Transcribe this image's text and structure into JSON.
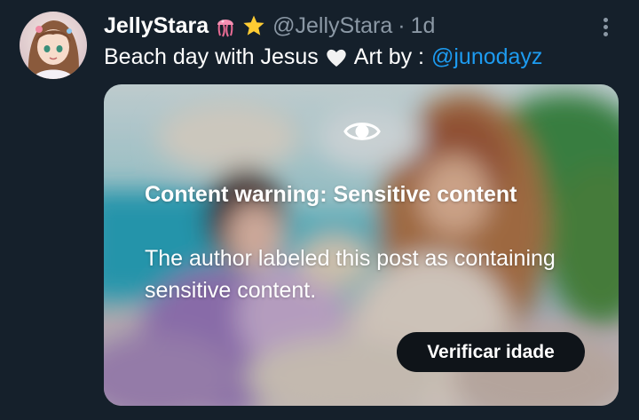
{
  "tweet": {
    "display_name": "JellyStara",
    "emojis": [
      "jellyfish-emoji",
      "star-emoji"
    ],
    "handle": "@JellyStara",
    "separator": "·",
    "time": "1d",
    "text_before": "Beach day with Jesus",
    "text_heart": "white-heart-emoji",
    "text_after": "Art by :",
    "mention": "@junodayz"
  },
  "media": {
    "warning_title": "Content warning: Sensitive content",
    "warning_body": "The author labeled this post as containing sensitive content.",
    "verify_button": "Verificar idade"
  },
  "colors": {
    "background": "#15202b",
    "muted_text": "#8b98a5",
    "link": "#1d9bf0",
    "button_bg": "#0f1419"
  }
}
